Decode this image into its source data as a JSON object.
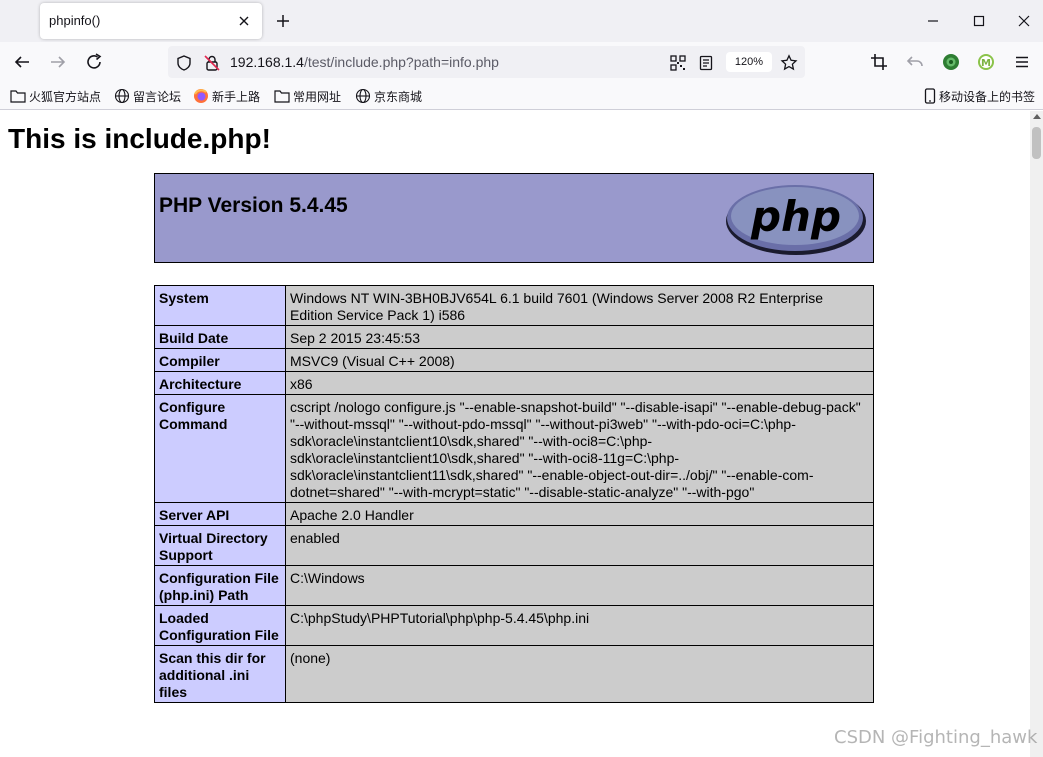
{
  "browser": {
    "tab_title": "phpinfo()",
    "url": {
      "host": "192.168.1.4",
      "path": "/test/include.php?path=info.php"
    },
    "zoom_level": "120%",
    "bookmarks": [
      {
        "label": "火狐官方站点",
        "icon": "folder-icon"
      },
      {
        "label": "留言论坛",
        "icon": "globe-icon"
      },
      {
        "label": "新手上路",
        "icon": "firefox-icon"
      },
      {
        "label": "常用网址",
        "icon": "folder-icon"
      },
      {
        "label": "京东商城",
        "icon": "globe-icon"
      }
    ],
    "mobile_bookmarks": "移动设备上的书签",
    "accent_color": "#0061e0"
  },
  "page": {
    "heading": "This is include.php!",
    "php_version": "PHP Version 5.4.45",
    "logo_text": "php",
    "info_rows": [
      {
        "key": "System",
        "value": "Windows NT WIN-3BH0BJV654L 6.1 build 7601 (Windows Server 2008 R2 Enterprise Edition Service Pack 1) i586"
      },
      {
        "key": "Build Date",
        "value": "Sep 2 2015 23:45:53"
      },
      {
        "key": "Compiler",
        "value": "MSVC9 (Visual C++ 2008)"
      },
      {
        "key": "Architecture",
        "value": "x86"
      },
      {
        "key": "Configure Command",
        "value": "cscript /nologo configure.js \"--enable-snapshot-build\" \"--disable-isapi\" \"--enable-debug-pack\" \"--without-mssql\" \"--without-pdo-mssql\" \"--without-pi3web\" \"--with-pdo-oci=C:\\php-sdk\\oracle\\instantclient10\\sdk,shared\" \"--with-oci8=C:\\php-sdk\\oracle\\instantclient10\\sdk,shared\" \"--with-oci8-11g=C:\\php-sdk\\oracle\\instantclient11\\sdk,shared\" \"--enable-object-out-dir=../obj/\" \"--enable-com-dotnet=shared\" \"--with-mcrypt=static\" \"--disable-static-analyze\" \"--with-pgo\""
      },
      {
        "key": "Server API",
        "value": "Apache 2.0 Handler"
      },
      {
        "key": "Virtual Directory Support",
        "value": "enabled"
      },
      {
        "key": "Configuration File (php.ini) Path",
        "value": "C:\\Windows"
      },
      {
        "key": "Loaded Configuration File",
        "value": "C:\\phpStudy\\PHPTutorial\\php\\php-5.4.45\\php.ini"
      },
      {
        "key": "Scan this dir for additional .ini files",
        "value": "(none)"
      }
    ],
    "colors": {
      "header_bg": "#9999cc",
      "key_bg": "#ccccff",
      "value_bg": "#cccccc"
    }
  },
  "watermark": "CSDN @Fighting_hawk"
}
